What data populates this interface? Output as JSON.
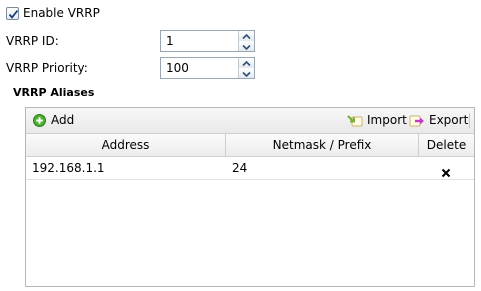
{
  "enable_vrrp": {
    "label": "Enable VRRP",
    "checked": true
  },
  "vrrp_id": {
    "label": "VRRP ID:",
    "value": "1"
  },
  "vrrp_priority": {
    "label": "VRRP Priority:",
    "value": "100"
  },
  "aliases": {
    "title": "VRRP Aliases",
    "toolbar": {
      "add_label": "Add",
      "import_label": "Import",
      "export_label": "Export"
    },
    "columns": [
      "Address",
      "Netmask / Prefix",
      "Delete"
    ],
    "rows": [
      {
        "address": "192.168.1.1",
        "netmask": "24",
        "delete_icon": "close-icon"
      }
    ]
  },
  "colors": {
    "add_icon": "#4caf2f",
    "import_icon": "#7cae3a",
    "export_icon": "#c23cbf"
  }
}
